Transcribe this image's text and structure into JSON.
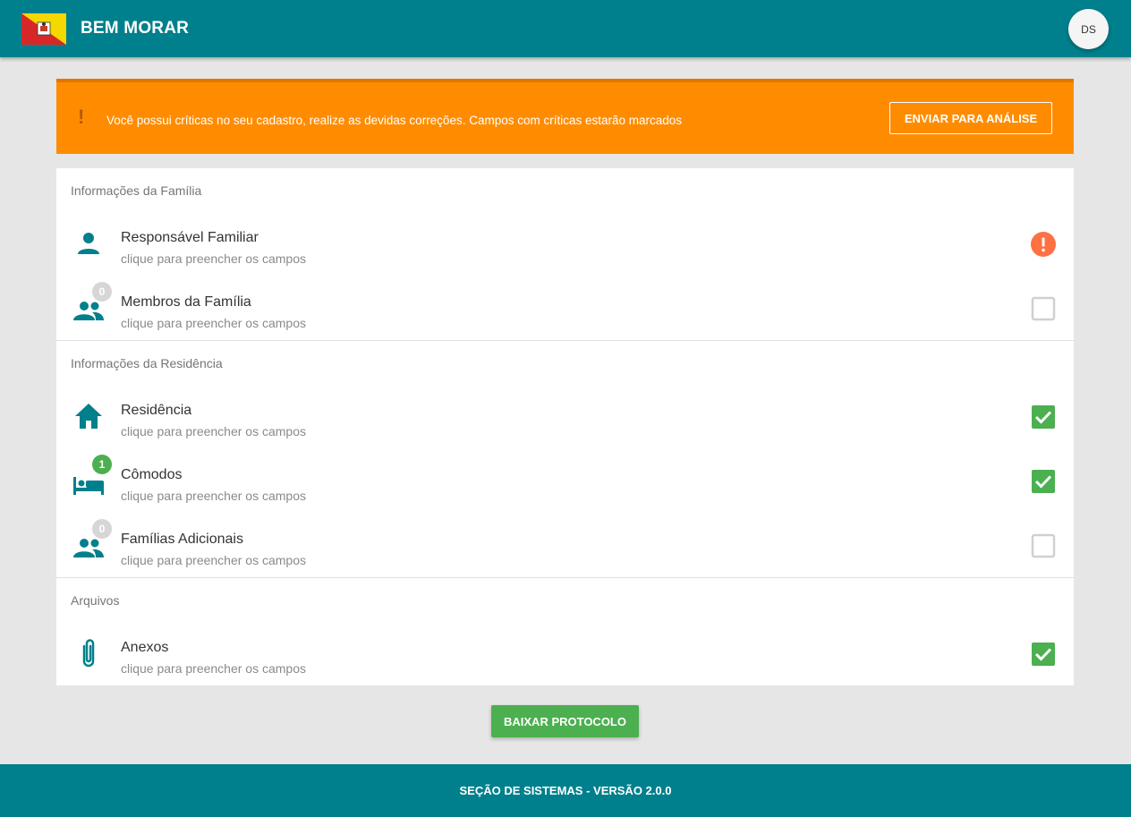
{
  "header": {
    "title": "BEM MORAR",
    "avatar_initials": "DS"
  },
  "alert": {
    "icon": "!",
    "message": "Você possui críticas no seu cadastro, realize as devidas correções. Campos com críticas estarão marcados",
    "button_label": "ENVIAR PARA ANÁLISE"
  },
  "sections": [
    {
      "title": "Informações da Família",
      "items": [
        {
          "title": "Responsável Familiar",
          "subtitle": "clique para preencher os campos",
          "icon": "person-icon",
          "badge": null,
          "status": "error"
        },
        {
          "title": "Membros da Família",
          "subtitle": "clique para preencher os campos",
          "icon": "people-icon",
          "badge": "0",
          "status": "empty"
        }
      ]
    },
    {
      "title": "Informações da Residência",
      "items": [
        {
          "title": "Residência",
          "subtitle": "clique para preencher os campos",
          "icon": "home-icon",
          "badge": null,
          "status": "checked"
        },
        {
          "title": "Cômodos",
          "subtitle": "clique para preencher os campos",
          "icon": "bed-icon",
          "badge": "1",
          "status": "checked"
        },
        {
          "title": "Famílias Adicionais",
          "subtitle": "clique para preencher os campos",
          "icon": "people-icon",
          "badge": "0",
          "status": "empty"
        }
      ]
    },
    {
      "title": "Arquivos",
      "items": [
        {
          "title": "Anexos",
          "subtitle": "clique para preencher os campos",
          "icon": "paperclip-icon",
          "badge": null,
          "status": "checked"
        }
      ]
    }
  ],
  "download_button": "BAIXAR PROTOCOLO",
  "footer": "SEÇÃO DE SISTEMAS - VERSÃO 2.0.0",
  "colors": {
    "primary": "#00808c",
    "warning": "#ff8c00",
    "success": "#4caf50",
    "error": "#ff7043",
    "badge_active": "#4caf50",
    "badge_inactive": "#d6d6d6"
  }
}
